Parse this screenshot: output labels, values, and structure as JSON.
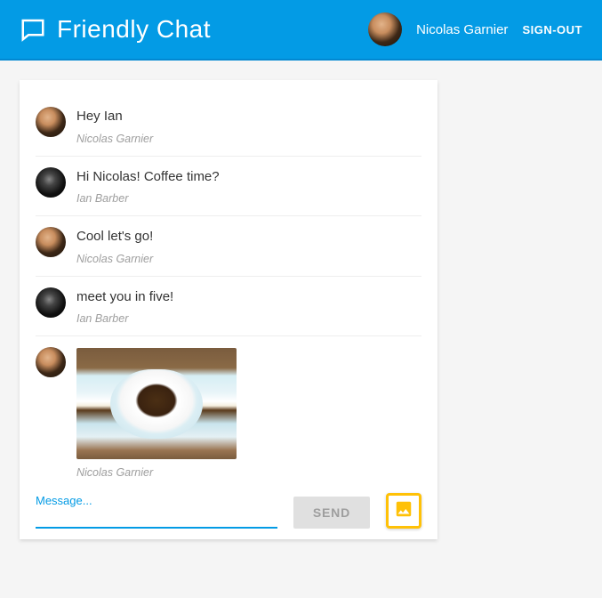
{
  "header": {
    "app_title": "Friendly Chat",
    "username": "Nicolas Garnier",
    "signout_label": "SIGN-OUT"
  },
  "messages": [
    {
      "author": "Nicolas Garnier",
      "avatar": "nicolas",
      "text": "Hey Ian",
      "type": "text"
    },
    {
      "author": "Ian Barber",
      "avatar": "ian",
      "text": "Hi Nicolas! Coffee time?",
      "type": "text"
    },
    {
      "author": "Nicolas Garnier",
      "avatar": "nicolas",
      "text": "Cool let's go!",
      "type": "text"
    },
    {
      "author": "Ian Barber",
      "avatar": "ian",
      "text": "meet you in five!",
      "type": "text"
    },
    {
      "author": "Nicolas Garnier",
      "avatar": "nicolas",
      "image_desc": "cup of coffee on saucer",
      "type": "image"
    }
  ],
  "composer": {
    "placeholder": "Message...",
    "value": "",
    "send_label": "SEND"
  },
  "colors": {
    "primary": "#039be5",
    "accent": "#ffc107"
  }
}
